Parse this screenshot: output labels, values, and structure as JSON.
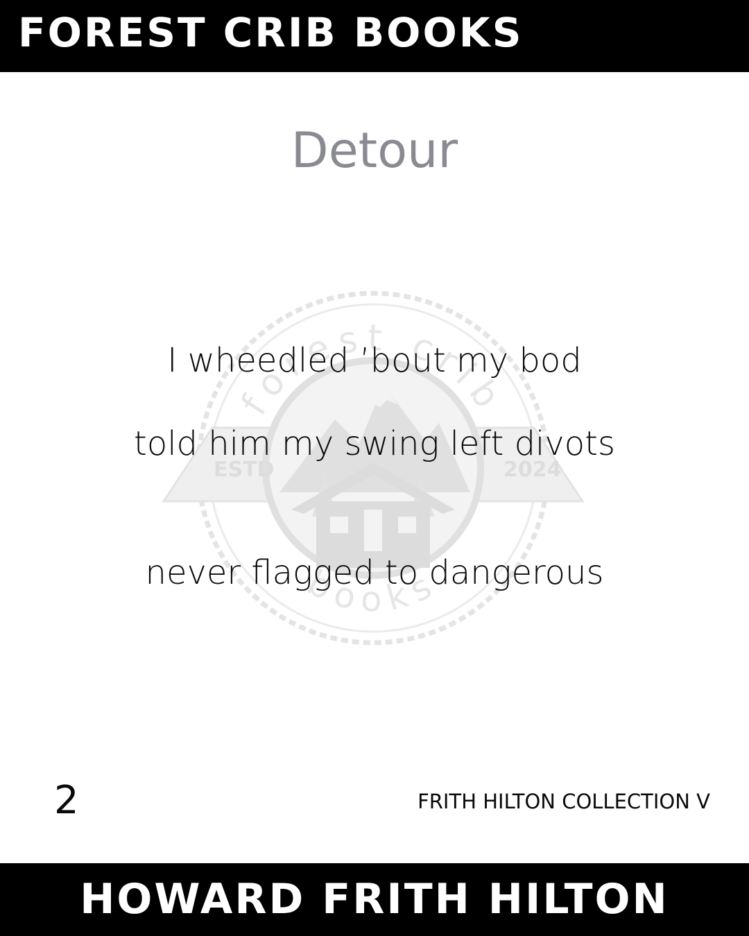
{
  "header": {
    "brand": "FOREST CRIB BOOKS"
  },
  "poem": {
    "title": "Detour",
    "lines": [
      "I wheedled ’bout my bod",
      "told him my swing left divots",
      "never flagged to dangerous"
    ]
  },
  "footer": {
    "page_number": "2",
    "collection": "FRITH HILTON COLLECTION V",
    "author": "HOWARD FRITH HILTON"
  },
  "watermark": {
    "icon": "forest-crib-books-seal-icon",
    "text_top": "forest crib",
    "text_bottom": "books",
    "estd_label": "ESTD",
    "year": "2024"
  },
  "colors": {
    "bar": "#000000",
    "title": "#8a8a93",
    "text": "#0a0a0a",
    "watermark": "#e2e2e2"
  }
}
